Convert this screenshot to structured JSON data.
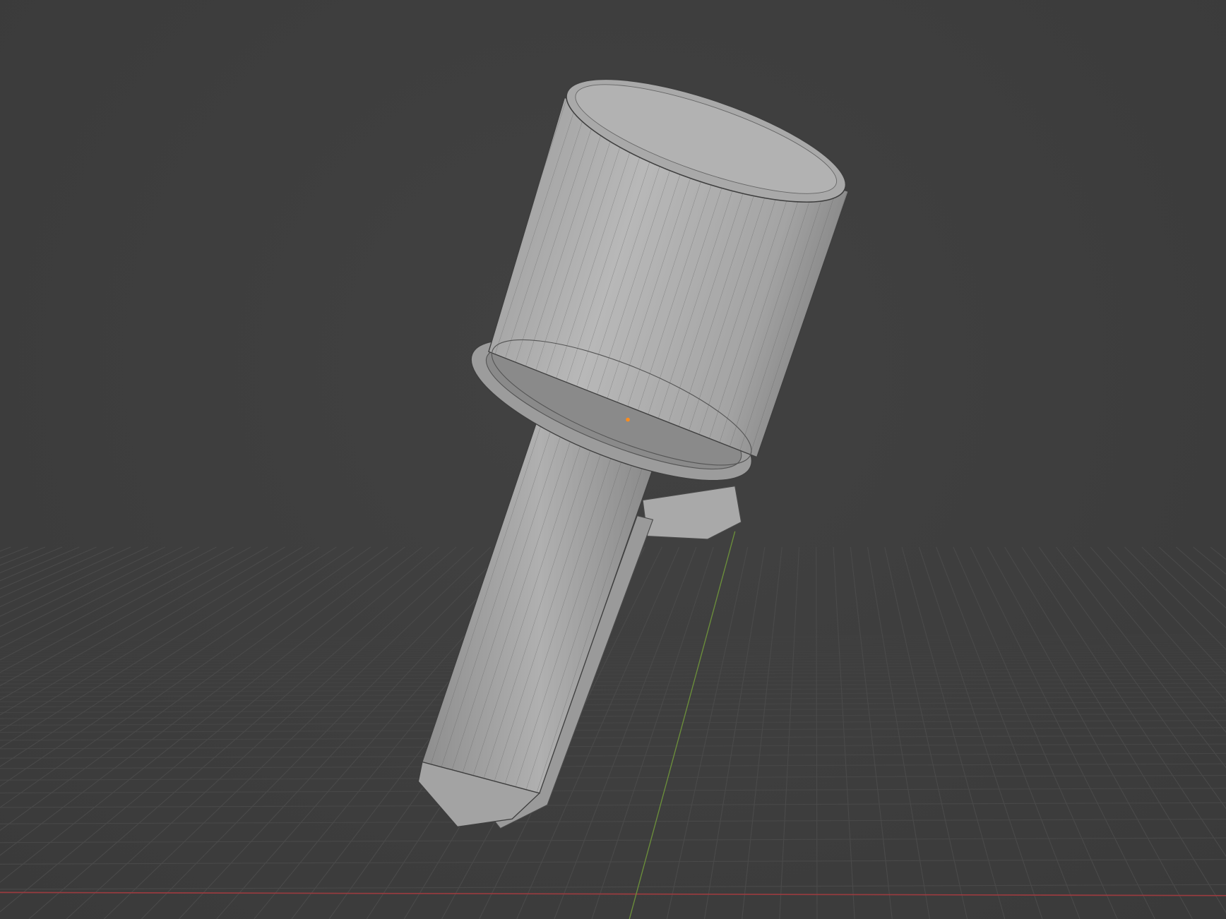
{
  "viewport": {
    "background_color": "#3d3d3d",
    "grid_color": "#4a4a4a",
    "x_axis_color": "#9a3b3f",
    "y_axis_color": "#6b8f3a",
    "mesh_color": "#a8a8a8",
    "origin_color": "#ff8c1a"
  }
}
